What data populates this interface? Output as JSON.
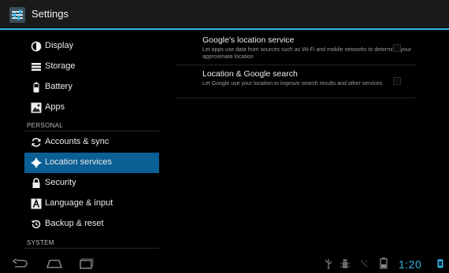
{
  "app": {
    "title": "Settings"
  },
  "sidebar": {
    "items": [
      {
        "label": "Display",
        "icon": "display-icon"
      },
      {
        "label": "Storage",
        "icon": "storage-icon"
      },
      {
        "label": "Battery",
        "icon": "battery-icon"
      },
      {
        "label": "Apps",
        "icon": "apps-icon"
      },
      {
        "label": "Accounts & sync",
        "icon": "sync-icon"
      },
      {
        "label": "Location services",
        "icon": "location-icon",
        "selected": true
      },
      {
        "label": "Security",
        "icon": "lock-icon"
      },
      {
        "label": "Language & input",
        "icon": "language-icon"
      },
      {
        "label": "Backup & reset",
        "icon": "backup-icon"
      }
    ],
    "sections": [
      {
        "label": "PERSONAL"
      },
      {
        "label": "SYSTEM"
      }
    ]
  },
  "main": {
    "prefs": [
      {
        "title": "Google's location service",
        "summary": "Let apps use data from sources such as Wi-Fi and mobile networks to determine your approximate location",
        "checked": false
      },
      {
        "title": "Location & Google search",
        "summary": "Let Google use your location to improve search results and other services",
        "checked": false
      }
    ]
  },
  "statusbar": {
    "time": "1:20"
  },
  "colors": {
    "accent": "#33b5e5",
    "selected": "#0a5f95",
    "actionbar": "#1a1a1a"
  }
}
